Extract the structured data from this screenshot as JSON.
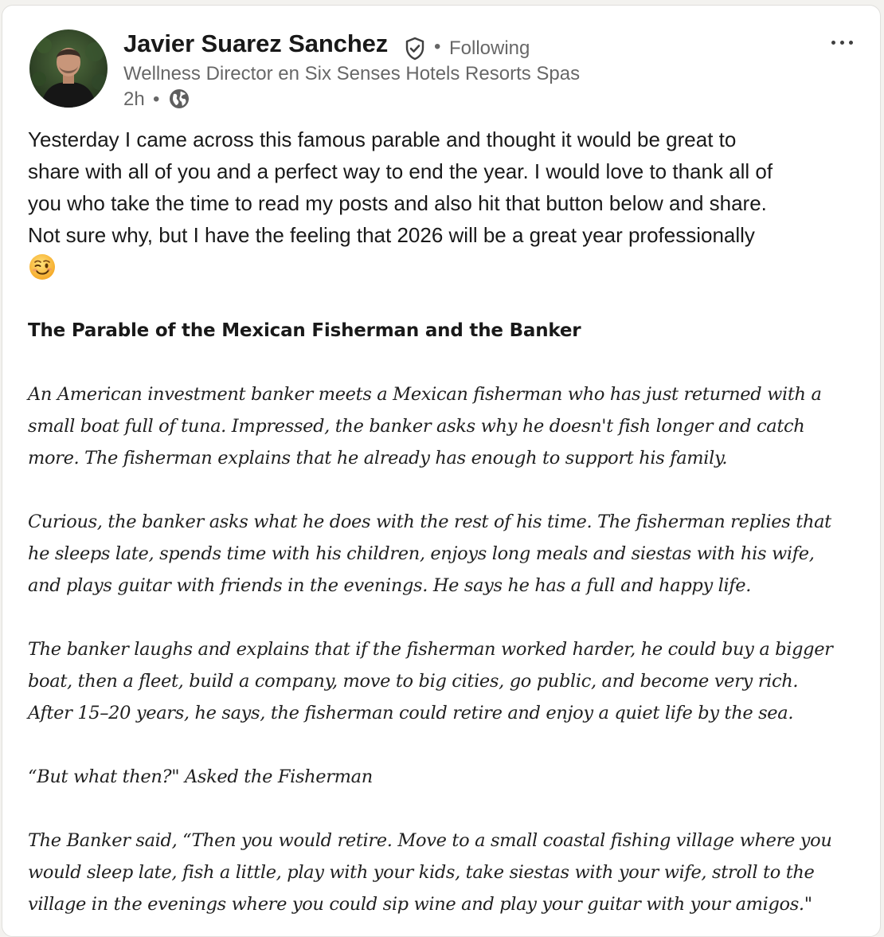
{
  "post": {
    "author": {
      "name": "Javier Suarez Sanchez",
      "follow_separator": "•",
      "follow_status": "Following",
      "headline": "Wellness Director en Six Senses Hotels Resorts Spas",
      "timestamp": "2h",
      "time_separator": "•",
      "avatar_icon": "avatar-photo",
      "verified_icon": "verified-shield-icon",
      "visibility_icon": "globe-icon"
    },
    "more_icon": "more-horizontal-icon",
    "intro_lines": [
      "Yesterday I came across this famous parable and thought it would be great to",
      "share with all of you and a perfect way to end the year. I would love to thank all of",
      "you who take the time to read my posts and also hit that button below and share.",
      "Not sure why, but I have the feeling that 2026 will be a great year professionally"
    ],
    "intro_emoji": "winking-face",
    "parable_title": "The Parable of the Mexican Fisherman and the Banker",
    "paragraphs": [
      [
        "An American investment banker meets a Mexican fisherman who has just returned with a",
        "small boat full of tuna. Impressed, the banker asks why he doesn't fish longer and catch",
        "more. The fisherman explains that he already has enough to support his family."
      ],
      [
        "Curious, the banker asks what he does with the rest of his time. The fisherman replies that",
        "he sleeps late, spends time with his children, enjoys long meals and siestas with his wife,",
        "and plays guitar with friends in the evenings. He says he has a full and happy life."
      ],
      [
        "The banker laughs and explains that if the fisherman worked harder, he could buy a bigger",
        "boat, then a fleet, build a company, move to big cities, go public, and become very rich.",
        "After 15–20 years, he says, the fisherman could retire and enjoy a quiet life by the sea."
      ],
      [
        "“But what then?\" Asked the Fisherman"
      ],
      [
        "The Banker said, “Then you would retire. Move to a small coastal fishing village where you",
        "would sleep late, fish a little, play with your kids, take siestas with your wife, stroll to the",
        "village in the evenings where you could sip wine and play your guitar with your amigos.\""
      ]
    ]
  },
  "colors": {
    "text_primary": "#191919",
    "text_secondary": "#666666",
    "background": "#ffffff"
  }
}
